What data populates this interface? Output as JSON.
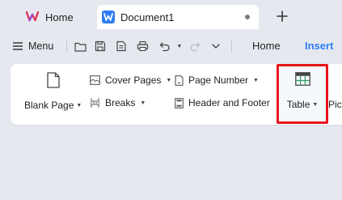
{
  "tabs": {
    "home_label": "Home",
    "document_label": "Document1"
  },
  "toolbar": {
    "menu_label": "Menu",
    "ribbon_tabs": [
      "Home",
      "Insert"
    ]
  },
  "ribbon": {
    "blank_page": "Blank Page",
    "cover_pages": "Cover Pages",
    "breaks": "Breaks",
    "page_number": "Page Number",
    "header_footer": "Header and Footer",
    "table": "Table",
    "pictures_partial": "Pict"
  },
  "colors": {
    "accent": "#2f7cf6",
    "highlight_border": "#e8141a"
  }
}
